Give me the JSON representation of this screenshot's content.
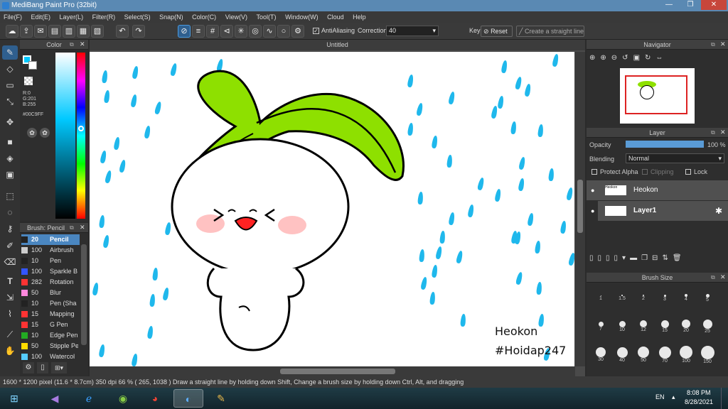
{
  "window": {
    "title": "MediBang Paint Pro (32bit)",
    "controls": [
      "—",
      "❐",
      "✕"
    ]
  },
  "menu": [
    "File(F)",
    "Edit(E)",
    "Layer(L)",
    "Filter(R)",
    "Select(S)",
    "Snap(N)",
    "Color(C)",
    "View(V)",
    "Tool(T)",
    "Window(W)",
    "Cloud",
    "Help"
  ],
  "toolbar": {
    "antialiasing_label": "AntiAliasing",
    "correction_label": "Correction",
    "correction_value": "40",
    "key_label": "Key",
    "reset_label": "Reset",
    "straight_line_label": "Create a straight line"
  },
  "color_panel": {
    "title": "Color",
    "r": "R:0",
    "g": "G:201",
    "b": "B:255",
    "hex": "#00C9FF",
    "fg_color": "#00C9FF"
  },
  "brush_panel": {
    "title": "Brush: Pencil",
    "items": [
      {
        "size": "20",
        "name": "Pencil",
        "color": "#222222"
      },
      {
        "size": "100",
        "name": "Airbrush",
        "color": "#cccccc"
      },
      {
        "size": "10",
        "name": "Pen",
        "color": "#222222"
      },
      {
        "size": "100",
        "name": "Sparkle B",
        "color": "#3355ff"
      },
      {
        "size": "282",
        "name": "Rotation",
        "color": "#ff3333"
      },
      {
        "size": "50",
        "name": "Blur",
        "color": "#ff88dd"
      },
      {
        "size": "10",
        "name": "Pen (Sha",
        "color": "#222222"
      },
      {
        "size": "15",
        "name": "Mapping",
        "color": "#ff3333"
      },
      {
        "size": "15",
        "name": "G Pen",
        "color": "#ff3333"
      },
      {
        "size": "10",
        "name": "Edge Pen",
        "color": "#22aa22"
      },
      {
        "size": "50",
        "name": "Stipple Pe",
        "color": "#ffdd00"
      },
      {
        "size": "100",
        "name": "Watercol",
        "color": "#55ccff"
      }
    ]
  },
  "canvas": {
    "tab": "Untitled",
    "signature_line1": "Heokon",
    "signature_line2": "#Hoidap247"
  },
  "navigator": {
    "title": "Navigator"
  },
  "layer_panel": {
    "title": "Layer",
    "opacity_label": "Opacity",
    "opacity_value": "100 %",
    "opacity_fraction": 1.0,
    "blending_label": "Blending",
    "blending_value": "Normal",
    "protect_alpha": "Protect Alpha",
    "clipping": "Clipping",
    "lock": "Lock",
    "layers": [
      {
        "name": "Heokon"
      },
      {
        "name": "Layer1"
      }
    ]
  },
  "brush_size_panel": {
    "title": "Brush Size",
    "sizes": [
      "1",
      "1.5",
      "2",
      "3",
      "4",
      "5",
      "7",
      "10",
      "12",
      "15",
      "20",
      "25",
      "30",
      "40",
      "50",
      "70",
      "100",
      "150"
    ]
  },
  "status": "1600 * 1200 pixel   (11.6 * 8.7cm)   350 dpi   66 %   ( 265, 1038 )   Draw a straight line by holding down Shift, Change a brush size by holding down Ctrl, Alt, and dragging",
  "taskbar": {
    "language": "EN",
    "time": "8:08 PM",
    "date": "8/28/2021"
  }
}
